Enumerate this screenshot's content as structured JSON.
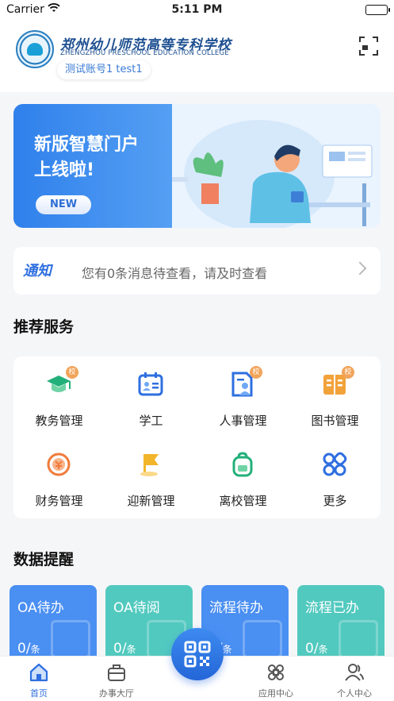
{
  "status_bar": {
    "carrier": "Carrier",
    "time": "5:11 PM"
  },
  "header": {
    "college_cn": "郑州幼儿师范高等专科学校",
    "college_en": "ZHENGZHOU PRESCHOOL EDUCATION COLLEGE",
    "account": "测试账号1 test1"
  },
  "banner": {
    "line1": "新版智慧门户",
    "line2": "上线啦!",
    "button": "NEW"
  },
  "notice": {
    "tag": "通知",
    "message": "您有0条消息待查看，请及时查看"
  },
  "recommended": {
    "title": "推荐服务",
    "items": [
      {
        "label": "教务管理",
        "icon": "graduation-cap-icon",
        "badge": "校",
        "color": "#22b07a"
      },
      {
        "label": "学工",
        "icon": "id-card-icon",
        "badge": "",
        "color": "#2f6fe0"
      },
      {
        "label": "人事管理",
        "icon": "person-file-icon",
        "badge": "校",
        "color": "#2f6fe0"
      },
      {
        "label": "图书管理",
        "icon": "book-icon",
        "badge": "校",
        "color": "#f2a23a"
      },
      {
        "label": "财务管理",
        "icon": "coin-icon",
        "badge": "",
        "color": "#f07b3a"
      },
      {
        "label": "迎新管理",
        "icon": "flag-icon",
        "badge": "",
        "color": "#f2b52a"
      },
      {
        "label": "离校管理",
        "icon": "backpack-icon",
        "badge": "",
        "color": "#22b07a"
      },
      {
        "label": "更多",
        "icon": "grid-icon",
        "badge": "",
        "color": "#2f6fe0"
      }
    ]
  },
  "data_reminder": {
    "title": "数据提醒",
    "cards": [
      {
        "title": "OA待办",
        "value": "0",
        "unit": "条",
        "color": "#4a8ff2"
      },
      {
        "title": "OA待阅",
        "value": "0",
        "unit": "条",
        "color": "#52c9bf"
      },
      {
        "title": "流程待办",
        "value": "0",
        "unit": "条",
        "color": "#4a8ff2"
      },
      {
        "title": "流程已办",
        "value": "0",
        "unit": "条",
        "color": "#52c9bf"
      }
    ]
  },
  "tabbar": {
    "items": [
      {
        "label": "首页",
        "icon": "home-icon",
        "active": true
      },
      {
        "label": "办事大厅",
        "icon": "briefcase-icon",
        "active": false
      },
      {
        "label": "应用中心",
        "icon": "apps-icon",
        "active": false
      },
      {
        "label": "个人中心",
        "icon": "user-icon",
        "active": false
      }
    ]
  },
  "colors": {
    "accent": "#2f6fe0",
    "background": "#f5f6f8"
  }
}
